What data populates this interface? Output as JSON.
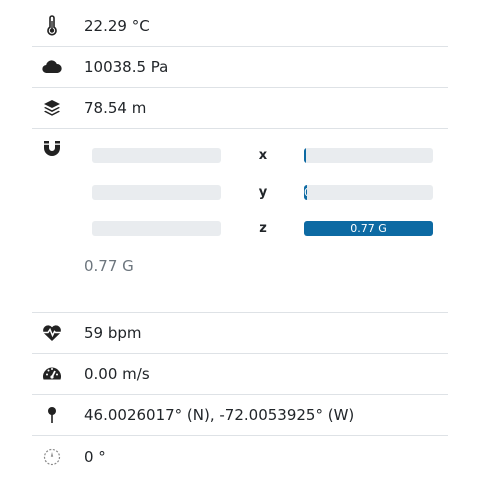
{
  "sensors": {
    "temperature": {
      "value": "22.29 °C",
      "icon": "thermometer-icon"
    },
    "pressure": {
      "value": "10038.5 Pa",
      "icon": "cloud-icon"
    },
    "altitude": {
      "value": "78.54 m",
      "icon": "layers-icon"
    },
    "magnetometer": {
      "icon": "magnet-icon",
      "axes": [
        {
          "label": "x",
          "value": "",
          "fill_fraction": 0.0
        },
        {
          "label": "y",
          "value": "0",
          "fill_fraction": 0.02
        },
        {
          "label": "z",
          "value": "0.77 G",
          "fill_fraction": 1.0
        }
      ],
      "total": "0.77 G"
    },
    "heart_rate": {
      "value": "59 bpm",
      "icon": "heart-pulse-icon"
    },
    "speed": {
      "value": "0.00 m/s",
      "icon": "speedometer-icon"
    },
    "location": {
      "value": "46.0026017° (N), -72.0053925° (W)",
      "icon": "map-pin-icon"
    },
    "heading": {
      "value": "0 °",
      "icon": "compass-icon"
    }
  },
  "colors": {
    "bar_fill": "#0d6aa3",
    "bar_track": "#e9ecef",
    "divider": "#dee2e6"
  }
}
